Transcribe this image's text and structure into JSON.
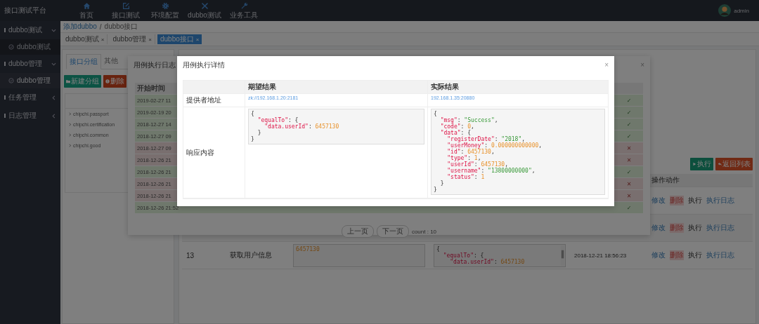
{
  "top_bar": {
    "logo": "接口测试平台",
    "nav": [
      {
        "label": "首页"
      },
      {
        "label": "接口测试"
      },
      {
        "label": "环境配置"
      },
      {
        "label": "dubbo测试"
      },
      {
        "label": "业务工具"
      }
    ],
    "user": "admin"
  },
  "sidebar": {
    "items": [
      {
        "label": "dubbo测试",
        "expanded": true,
        "children": [
          {
            "label": "dubbo测试",
            "selected": false
          }
        ]
      },
      {
        "label": "dubbo管理",
        "expanded": true,
        "children": [
          {
            "label": "dubbo管理",
            "selected": true
          }
        ]
      },
      {
        "label": "任务管理",
        "expanded": false
      },
      {
        "label": "日志管理",
        "expanded": false
      }
    ]
  },
  "breadcrumb": [
    {
      "label": "添加dubbo",
      "kind": "link"
    },
    {
      "label": "/",
      "kind": "separator"
    },
    {
      "label": "dubbo接口",
      "kind": "current"
    }
  ],
  "tabs": [
    {
      "label": "dubbo测试",
      "close": "×",
      "selected": false
    },
    {
      "label": "dubbo管理",
      "close": "×",
      "selected": false
    },
    {
      "label": "dubbo接口",
      "close": "×",
      "selected": true
    }
  ],
  "left_panel": {
    "tabs": [
      {
        "label": "接口分组",
        "selected": true
      },
      {
        "label": "其他",
        "selected": false
      }
    ],
    "buttons": [
      {
        "label": "新建分组",
        "kind": "primary"
      },
      {
        "label": "删除",
        "kind": "danger"
      }
    ],
    "tree": [
      {
        "label": "chipchi.passport"
      },
      {
        "label": "chipchi.certification"
      },
      {
        "label": "chipchi.common"
      },
      {
        "label": "chipchi.good"
      }
    ]
  },
  "case_table": {
    "buttons": [
      {
        "label": "执行",
        "kind": "run"
      },
      {
        "label": "返回列表",
        "kind": "back"
      }
    ],
    "header": "操作动作",
    "rows": [
      {
        "actions": [
          {
            "label": "修改",
            "kind": "edit"
          },
          {
            "label": "删除",
            "kind": "delete"
          },
          {
            "label": "执行",
            "kind": "run"
          },
          {
            "label": "执行日志",
            "kind": "log"
          }
        ]
      },
      {
        "actions": [
          {
            "label": "修改",
            "kind": "edit"
          },
          {
            "label": "删除",
            "kind": "delete"
          },
          {
            "label": "执行",
            "kind": "run"
          },
          {
            "label": "执行日志",
            "kind": "log"
          }
        ]
      },
      {
        "id": "13",
        "name": "获取用户信息",
        "expected": [
          [
            {
              "kind": "num",
              "text": "6457130"
            }
          ]
        ],
        "actual": [
          [
            {
              "kind": "p",
              "text": "{"
            }
          ],
          [
            {
              "kind": "key",
              "text": "  \"equalTo\""
            },
            {
              "kind": "p",
              "text": ": {"
            }
          ],
          [
            {
              "kind": "key",
              "text": "    \"data.userId\""
            },
            {
              "kind": "p",
              "text": ": "
            },
            {
              "kind": "num",
              "text": "6457130"
            }
          ]
        ],
        "time": "2018-12-21 18:56:23",
        "actions": [
          {
            "label": "修改",
            "kind": "edit"
          },
          {
            "label": "删除",
            "kind": "delete"
          },
          {
            "label": "执行",
            "kind": "run"
          },
          {
            "label": "执行日志",
            "kind": "log"
          }
        ]
      }
    ]
  },
  "log_dialog": {
    "title": "用例执行日志",
    "close": "×",
    "header": "开始时间",
    "rows": [
      {
        "start": "2019-02-27 11",
        "mark": "✓",
        "passed": true
      },
      {
        "start": "2019-02-19 20",
        "mark": "✓",
        "passed": true
      },
      {
        "start": "2018-12-27 14",
        "mark": "✓",
        "passed": true
      },
      {
        "start": "2018-12-27 09",
        "mark": "✓",
        "passed": true
      },
      {
        "start": "2018-12-27 09",
        "mark": "✕",
        "passed": false
      },
      {
        "start": "2018-12-26 21",
        "mark": "✕",
        "passed": false
      },
      {
        "start": "2018-12-26 21",
        "mark": "✓",
        "passed": true
      },
      {
        "start": "2018-12-26 21",
        "mark": "✕",
        "passed": false
      },
      {
        "start": "2018-12-26 21",
        "mark": "✕",
        "passed": false
      },
      {
        "start": "2018-12-26 21:52",
        "mark": "✓",
        "passed": true
      }
    ],
    "pager": {
      "prev": "上一页",
      "next": "下一页",
      "count": "count : 10"
    }
  },
  "detail_dialog": {
    "title": "用例执行详情",
    "close": "×",
    "columns": [
      "期望结果",
      "实际结果"
    ],
    "rows": [
      {
        "kind": "link",
        "label": "提供者地址",
        "expected": "zk://192.168.1.20:2181",
        "actual": "192.168.1.35:20880"
      },
      {
        "kind": "code",
        "label": "响应内容",
        "expected": [
          [
            {
              "kind": "p",
              "text": "{"
            }
          ],
          [
            {
              "kind": "key",
              "text": "  \"equalTo\""
            },
            {
              "kind": "p",
              "text": ": {"
            }
          ],
          [
            {
              "kind": "key",
              "text": "    \"data.userId\""
            },
            {
              "kind": "p",
              "text": ": "
            },
            {
              "kind": "num",
              "text": "6457130"
            }
          ],
          [
            {
              "kind": "p",
              "text": "  }"
            }
          ],
          [
            {
              "kind": "p",
              "text": "}"
            }
          ]
        ],
        "actual": [
          [
            {
              "kind": "p",
              "text": "{"
            }
          ],
          [
            {
              "kind": "key",
              "text": "  \"msg\""
            },
            {
              "kind": "p",
              "text": ": "
            },
            {
              "kind": "str",
              "text": "\"Success\""
            },
            {
              "kind": "p",
              "text": ","
            }
          ],
          [
            {
              "kind": "key",
              "text": "  \"code\""
            },
            {
              "kind": "p",
              "text": ": "
            },
            {
              "kind": "num",
              "text": "0"
            },
            {
              "kind": "p",
              "text": ","
            }
          ],
          [
            {
              "kind": "key",
              "text": "  \"data\""
            },
            {
              "kind": "p",
              "text": ": {"
            }
          ],
          [
            {
              "kind": "key",
              "text": "    \"registerDate\""
            },
            {
              "kind": "p",
              "text": ": "
            },
            {
              "kind": "str",
              "text": "\"2018\""
            },
            {
              "kind": "p",
              "text": ","
            }
          ],
          [
            {
              "kind": "key",
              "text": "    \"userMoney\""
            },
            {
              "kind": "p",
              "text": ": "
            },
            {
              "kind": "num",
              "text": "0.000000000000"
            },
            {
              "kind": "p",
              "text": ","
            }
          ],
          [
            {
              "kind": "key",
              "text": "    \"id\""
            },
            {
              "kind": "p",
              "text": ": "
            },
            {
              "kind": "num",
              "text": "6457130"
            },
            {
              "kind": "p",
              "text": ","
            }
          ],
          [
            {
              "kind": "key",
              "text": "    \"type\""
            },
            {
              "kind": "p",
              "text": ": "
            },
            {
              "kind": "num",
              "text": "1"
            },
            {
              "kind": "p",
              "text": ","
            }
          ],
          [
            {
              "kind": "key",
              "text": "    \"userId\""
            },
            {
              "kind": "p",
              "text": ": "
            },
            {
              "kind": "num",
              "text": "6457130"
            },
            {
              "kind": "p",
              "text": ","
            }
          ],
          [
            {
              "kind": "key",
              "text": "    \"username\""
            },
            {
              "kind": "p",
              "text": ": "
            },
            {
              "kind": "str",
              "text": "\"13800000000\""
            },
            {
              "kind": "p",
              "text": ","
            }
          ],
          [
            {
              "kind": "key",
              "text": "    \"status\""
            },
            {
              "kind": "p",
              "text": ": "
            },
            {
              "kind": "num",
              "text": "1"
            }
          ],
          [
            {
              "kind": "p",
              "text": "  }"
            }
          ],
          [
            {
              "kind": "p",
              "text": "}"
            }
          ]
        ]
      }
    ]
  }
}
